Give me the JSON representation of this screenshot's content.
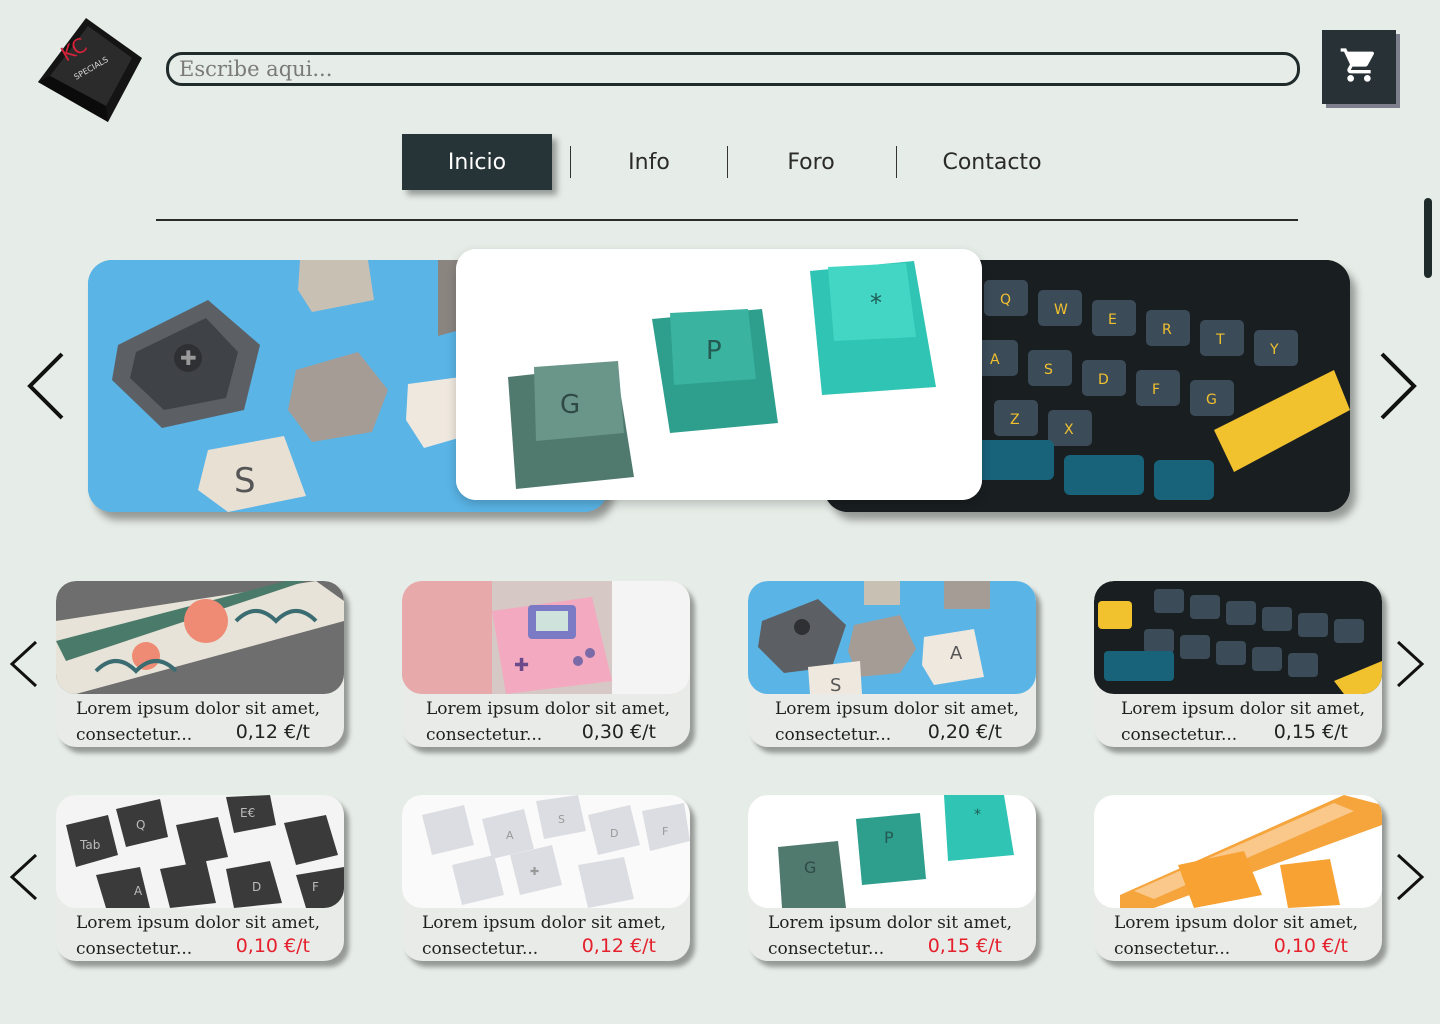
{
  "search": {
    "placeholder": "Escribe aqui..."
  },
  "logo": {
    "line1": "KC",
    "line2": "SPECIALS"
  },
  "nav": {
    "items": [
      {
        "label": "Inicio",
        "active": true
      },
      {
        "label": "Info"
      },
      {
        "label": "Foro"
      },
      {
        "label": "Contacto"
      }
    ]
  },
  "hero": {
    "slides": [
      "blue-keycaps",
      "green-teal-keycaps",
      "dark-keyboard"
    ],
    "center_keys": [
      "G",
      "P",
      "*"
    ]
  },
  "products": {
    "row1": [
      {
        "line1": "Lorem ipsum dolor sit amet,",
        "line2": "consectetur...",
        "price": "0,12 €/t"
      },
      {
        "line1": "Lorem ipsum dolor sit amet,",
        "line2": "consectetur...",
        "price": "0,30 €/t"
      },
      {
        "line1": "Lorem ipsum dolor sit amet,",
        "line2": "consectetur...",
        "price": "0,20 €/t"
      },
      {
        "line1": "Lorem ipsum dolor sit amet,",
        "line2": "consectetur...",
        "price": "0,15 €/t"
      }
    ],
    "row2": [
      {
        "line1": "Lorem ipsum dolor sit amet,",
        "line2": "consectetur...",
        "price": "0,10 €/t"
      },
      {
        "line1": "Lorem ipsum dolor sit amet,",
        "line2": "consectetur...",
        "price": "0,12 €/t"
      },
      {
        "line1": "Lorem ipsum dolor sit amet,",
        "line2": "consectetur...",
        "price": "0,15 €/t"
      },
      {
        "line1": "Lorem ipsum dolor sit amet,",
        "line2": "consectetur...",
        "price": "0,10 €/t"
      }
    ]
  },
  "colors": {
    "dark": "#263337",
    "sale": "#e5212d",
    "background": "#e6ece7"
  },
  "icons": [
    "cart-icon",
    "chevron-left-icon",
    "chevron-right-icon"
  ]
}
